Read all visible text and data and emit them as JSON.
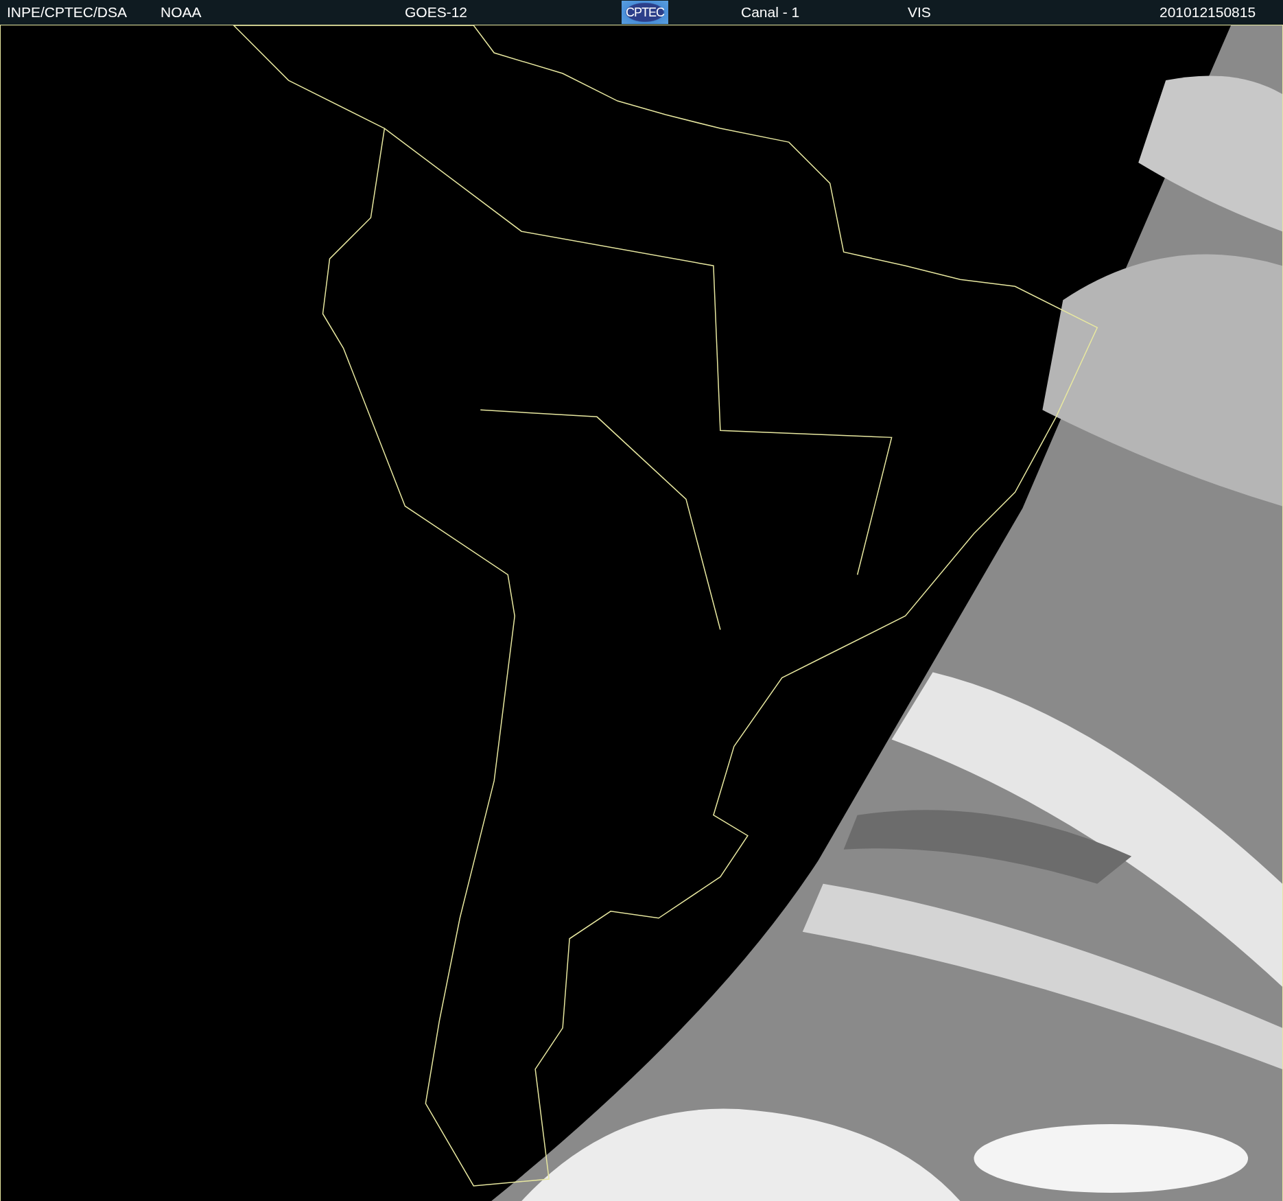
{
  "header": {
    "items": [
      {
        "kind": "text",
        "text": "INPE/CPTEC/DSA"
      },
      {
        "kind": "text",
        "text": "NOAA"
      },
      {
        "kind": "text",
        "text": "GOES-12"
      },
      {
        "kind": "logo",
        "text": "CPTEC"
      },
      {
        "kind": "text",
        "text": "Canal - 1"
      },
      {
        "kind": "text",
        "text": "VIS"
      },
      {
        "kind": "text",
        "text": "201012150815"
      }
    ]
  }
}
